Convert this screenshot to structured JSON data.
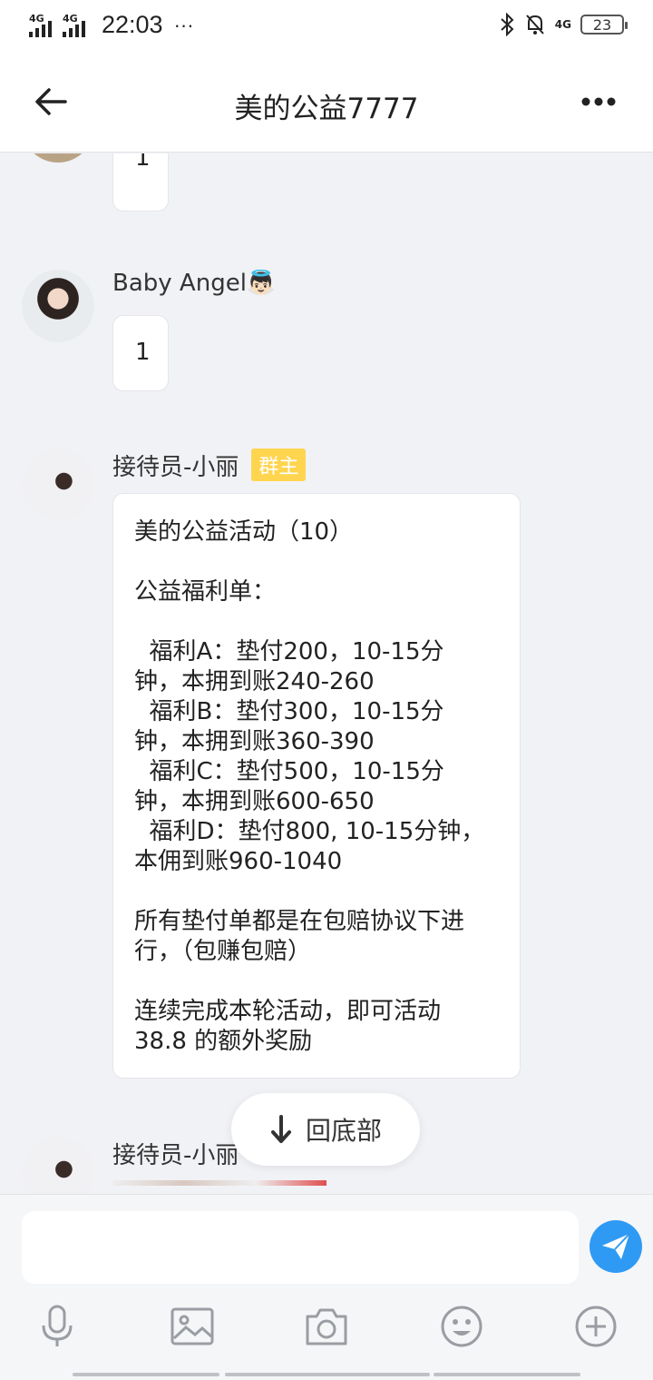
{
  "status_bar": {
    "signal1": "4G",
    "signal2": "4G",
    "time": "22:03",
    "dots": "···",
    "net": "4G",
    "battery": "23"
  },
  "header": {
    "title": "美的公益7777"
  },
  "messages": [
    {
      "text": "1"
    },
    {
      "name": "Baby Angel👼🏻",
      "text": "1"
    },
    {
      "name": "接待员-小丽",
      "badge": "群主",
      "text": "美的公益活动（10）\n\n公益福利单：\n\n  福利A：垫付200，10-15分\n钟，本拥到账240-260\n  福利B：垫付300，10-15分\n钟，本拥到账360-390\n  福利C：垫付500，10-15分\n钟，本拥到账600-650\n  福利D：垫付800, 10-15分钟，\n本佣到账960-1040\n\n所有垫付单都是在包赔协议下进\n行，（包赚包赔）\n\n连续完成本轮活动，即可活动\n38.8 的额外奖励"
    },
    {
      "name": "接待员-小丽"
    }
  ],
  "back_to_bottom": {
    "label": "回底部"
  },
  "input": {
    "placeholder": ""
  },
  "icons": {
    "back": "arrow-left-icon",
    "more": "more-dots-icon",
    "send": "paper-plane-icon",
    "tools": [
      "microphone-icon",
      "image-icon",
      "camera-icon",
      "emoji-icon",
      "plus-icon"
    ]
  },
  "colors": {
    "accent": "#2f9af3",
    "badge": "#ffd54f",
    "background": "#f1f2f6"
  }
}
